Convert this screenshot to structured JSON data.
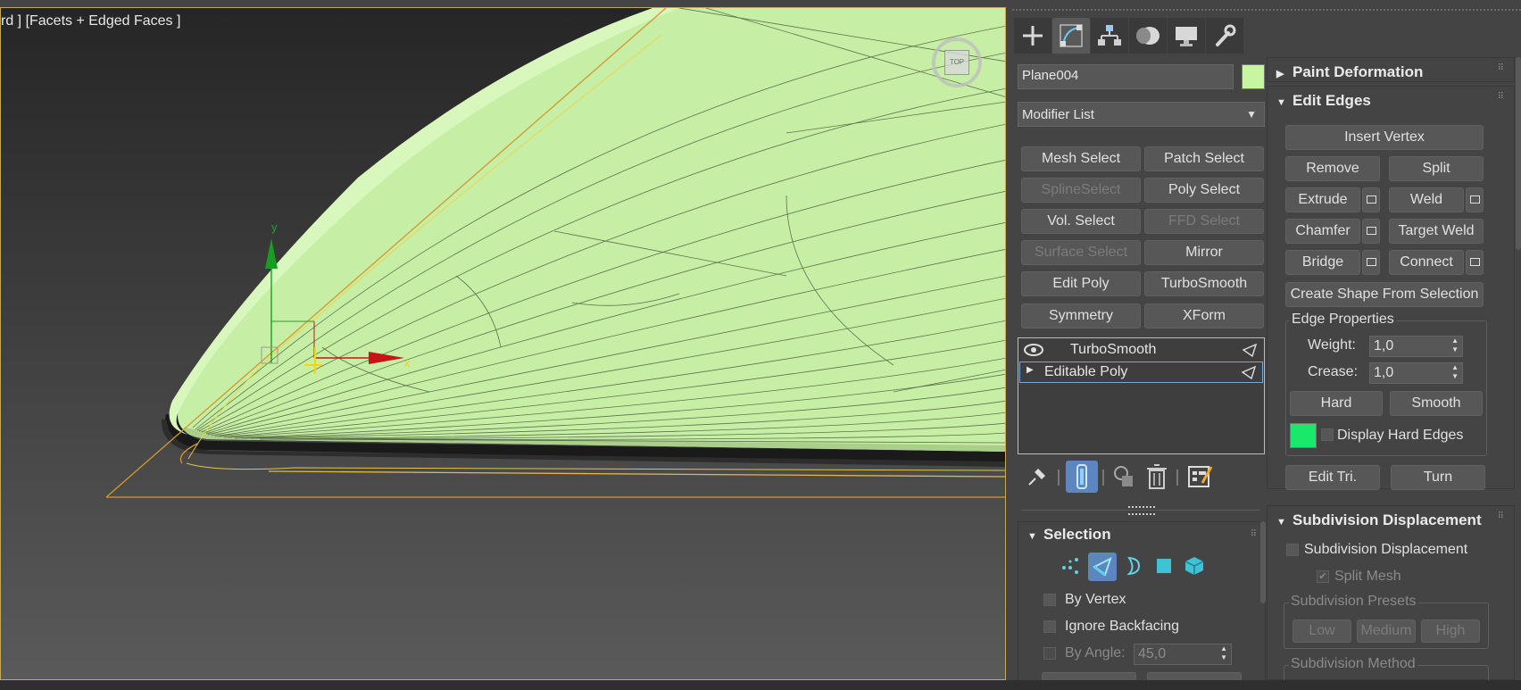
{
  "viewport": {
    "label": "rd ] [Facets + Edged Faces ]",
    "viewcube_label": "TOP",
    "gizmo_x": "x",
    "gizmo_y": "y"
  },
  "command_panel": {
    "tabs": [
      "create-tab",
      "modify-tab",
      "hierarchy-tab",
      "motion-tab",
      "display-tab",
      "utilities-tab"
    ],
    "active_tab": "modify-tab",
    "object_name": "Plane004",
    "object_color": "#c7f5a0",
    "modifier_list": "Modifier List",
    "modifier_buttons": [
      {
        "label": "Mesh Select",
        "enabled": true
      },
      {
        "label": "Patch Select",
        "enabled": true
      },
      {
        "label": "SplineSelect",
        "enabled": false
      },
      {
        "label": "Poly Select",
        "enabled": true
      },
      {
        "label": "Vol. Select",
        "enabled": true
      },
      {
        "label": "FFD Select",
        "enabled": false
      },
      {
        "label": "Surface Select",
        "enabled": false
      },
      {
        "label": "Mirror",
        "enabled": true
      },
      {
        "label": "Edit Poly",
        "enabled": true
      },
      {
        "label": "TurboSmooth",
        "enabled": true
      },
      {
        "label": "Symmetry",
        "enabled": true
      },
      {
        "label": "XForm",
        "enabled": true
      }
    ],
    "stack": [
      {
        "label": "TurboSmooth"
      },
      {
        "label": "Editable Poly",
        "selected": true
      }
    ],
    "stack_tools": [
      "pin-stack-icon",
      "show-end-result-icon",
      "make-unique-icon",
      "remove-modifier-icon",
      "configure-modifier-sets-icon"
    ]
  },
  "selection": {
    "title": "Selection",
    "modes": [
      "vertex-mode-icon",
      "edge-mode-icon",
      "border-mode-icon",
      "polygon-mode-icon",
      "element-mode-icon"
    ],
    "active_mode": "edge-mode-icon",
    "by_vertex": "By Vertex",
    "ignore_backfacing": "Ignore Backfacing",
    "by_angle": "By Angle:",
    "by_angle_value": "45,0"
  },
  "rollouts": {
    "paint_deformation": "Paint Deformation",
    "edit_edges": "Edit Edges",
    "subdivision_displacement": "Subdivision Displacement"
  },
  "edit_edges": {
    "insert_vertex": "Insert Vertex",
    "remove": "Remove",
    "split": "Split",
    "extrude": "Extrude",
    "weld": "Weld",
    "chamfer": "Chamfer",
    "target_weld": "Target Weld",
    "bridge": "Bridge",
    "connect": "Connect",
    "create_shape": "Create Shape From Selection",
    "edge_properties": "Edge Properties",
    "weight_label": "Weight:",
    "weight_value": "1,0",
    "crease_label": "Crease:",
    "crease_value": "1,0",
    "hard": "Hard",
    "smooth": "Smooth",
    "hard_edge_color": "#19e86a",
    "display_hard_edges": "Display Hard Edges",
    "edit_tri": "Edit Tri.",
    "turn": "Turn"
  },
  "subdivision": {
    "subdivision_displacement": "Subdivision Displacement",
    "split_mesh": "Split Mesh",
    "presets_title": "Subdivision Presets",
    "low": "Low",
    "medium": "Medium",
    "high": "High",
    "method_title": "Subdivision Method"
  }
}
